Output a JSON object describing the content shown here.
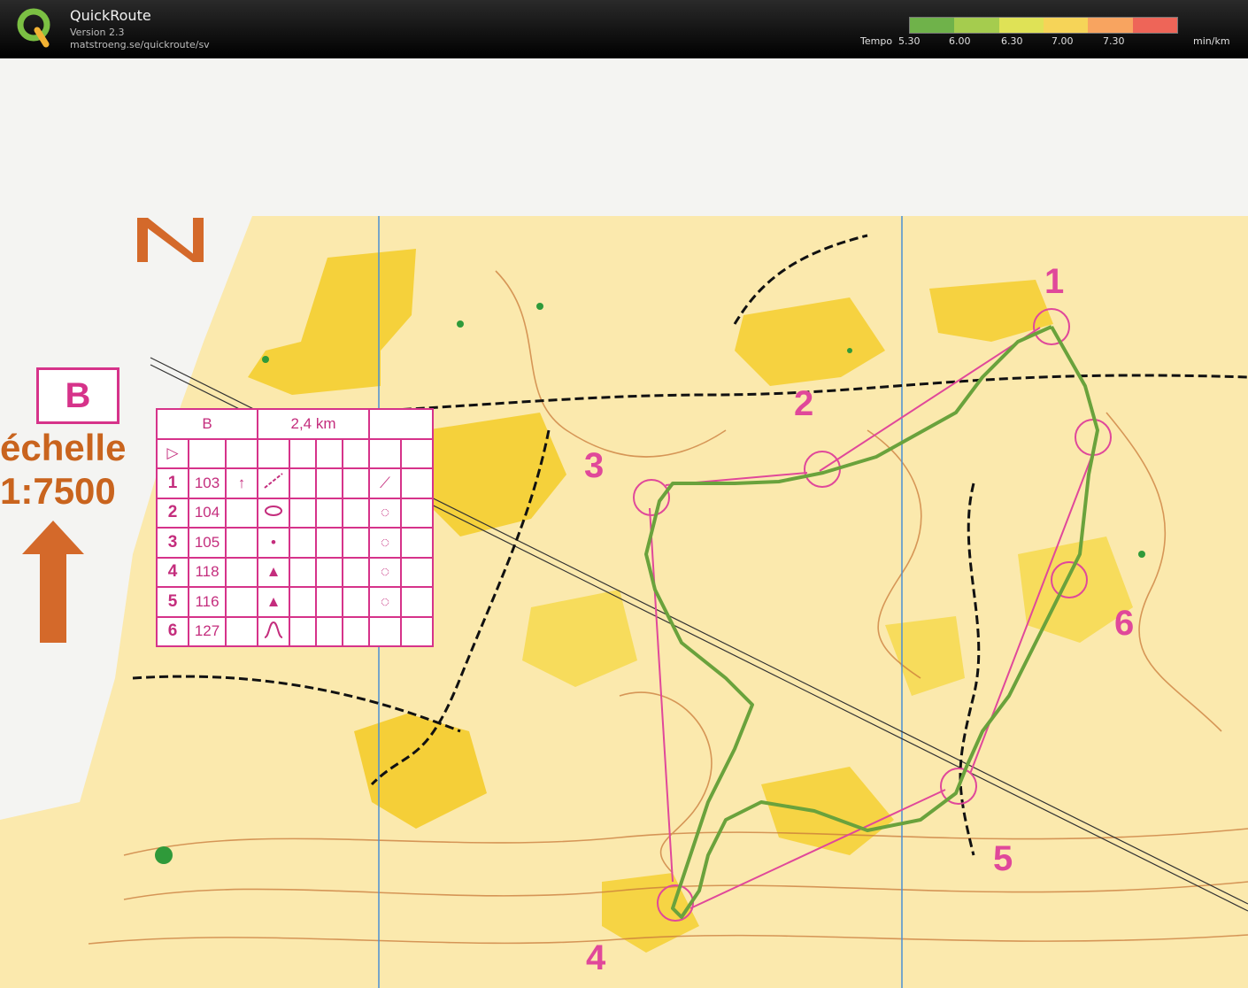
{
  "app": {
    "title": "QuickRoute",
    "version": "Version 2.3",
    "url": "matstroeng.se/quickroute/sv"
  },
  "pace_scale": {
    "label_prefix": "Tempo",
    "ticks": [
      "5.30",
      "6.00",
      "6.30",
      "7.00",
      "7.30"
    ],
    "unit": "min/km",
    "colors": [
      "#5aa83a",
      "#98c845",
      "#d8dc48",
      "#f3c84a",
      "#f3864c",
      "#e2424a"
    ]
  },
  "map": {
    "course_label": "B",
    "scale_word": "échelle",
    "scale_value": "1:7500",
    "controls": [
      "1",
      "2",
      "3",
      "4",
      "5",
      "6"
    ],
    "colors": {
      "course": "#e0489a",
      "route": "#5f9c3a",
      "contour": "#c97a3a",
      "yellow": "#f5d83a"
    }
  },
  "description_sheet": {
    "course": "B",
    "length": "2,4 km",
    "start_symbol": "▷",
    "rows": [
      {
        "num": "1",
        "code": "103",
        "c3": "↑",
        "c4": "spur-symbol",
        "c8": "⟋"
      },
      {
        "num": "2",
        "code": "104",
        "c3": "",
        "c4": "knoll-symbol",
        "c8": "◌"
      },
      {
        "num": "3",
        "code": "105",
        "c3": "",
        "c4": "•",
        "c8": "◌"
      },
      {
        "num": "4",
        "code": "118",
        "c3": "",
        "c4": "▲",
        "c8": "◌"
      },
      {
        "num": "5",
        "code": "116",
        "c3": "",
        "c4": "▲",
        "c8": "◌"
      },
      {
        "num": "6",
        "code": "127",
        "c3": "",
        "c4": "gully-symbol",
        "c8": ""
      }
    ]
  }
}
